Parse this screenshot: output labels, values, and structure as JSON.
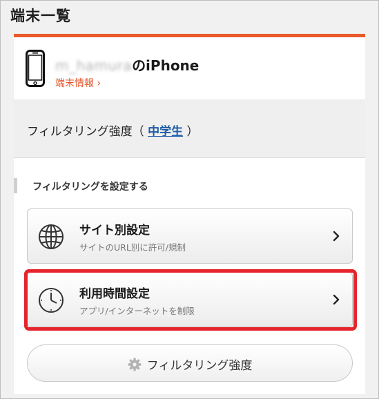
{
  "page": {
    "title": "端末一覧"
  },
  "device": {
    "name_blurred": "m_hamura",
    "name_suffix": "のiPhone",
    "info_link": "端末情報 ›"
  },
  "strength": {
    "prefix": "フィルタリング強度（ ",
    "level": "中学生",
    "suffix": " ）"
  },
  "section": {
    "title": "フィルタリングを設定する"
  },
  "menu": {
    "site": {
      "title": "サイト別設定",
      "subtitle": "サイトのURL別に許可/規制"
    },
    "time": {
      "title": "利用時間設定",
      "subtitle": "アプリ/インターネットを制限"
    }
  },
  "bottom_button": {
    "label": "フィルタリング強度"
  },
  "icons": {
    "device": "phone-icon",
    "site": "globe-icon",
    "time": "clock-icon",
    "chevron": "chevron-right-icon",
    "settings": "gear-icon"
  },
  "colors": {
    "accent": "#ea5a2b",
    "link_orange": "#e4572b",
    "link_blue": "#1d5ca8",
    "highlight": "#e5242b"
  }
}
